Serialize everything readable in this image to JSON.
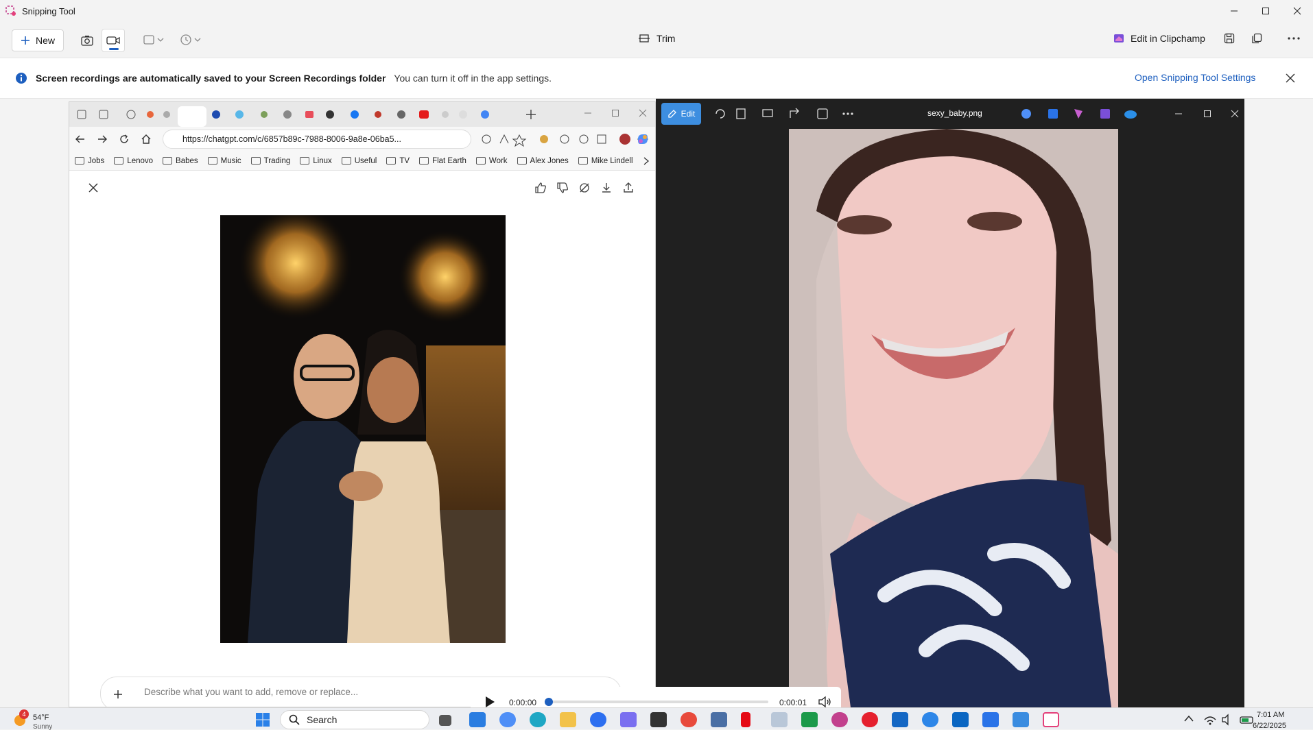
{
  "window": {
    "title": "Snipping Tool"
  },
  "toolbar": {
    "new_label": "New",
    "trim_label": "Trim",
    "clipchamp_label": "Edit in Clipchamp"
  },
  "infobar": {
    "bold_text": "Screen recordings are automatically saved to your Screen Recordings folder",
    "message": "You can turn it off in the app settings.",
    "settings_link": "Open Snipping Tool Settings"
  },
  "browser": {
    "url": "https://chatgpt.com/c/6857b89c-7988-8006-9a8e-06ba5...",
    "bookmarks": [
      "Jobs",
      "Lenovo",
      "Babes",
      "Music",
      "Trading",
      "Linux",
      "Useful",
      "TV",
      "Flat Earth",
      "Work",
      "Alex Jones",
      "Mike Lindell"
    ],
    "prompt_placeholder": "Describe what you want to add, remove or replace..."
  },
  "viewer": {
    "edit_label": "Edit",
    "file_name": "sexy_baby.png"
  },
  "player": {
    "current_time": "0:00:00",
    "duration": "0:00:01",
    "progress": 0.0
  },
  "taskbar": {
    "temperature": "54°F",
    "weather": "Sunny",
    "weather_badge": "4",
    "search_label": "Search",
    "time": "7:01 AM",
    "date": "6/22/2025"
  },
  "colors": {
    "accent": "#1d5fbf",
    "viewer_bg": "#202020",
    "edit_button": "#3d8ee0"
  }
}
